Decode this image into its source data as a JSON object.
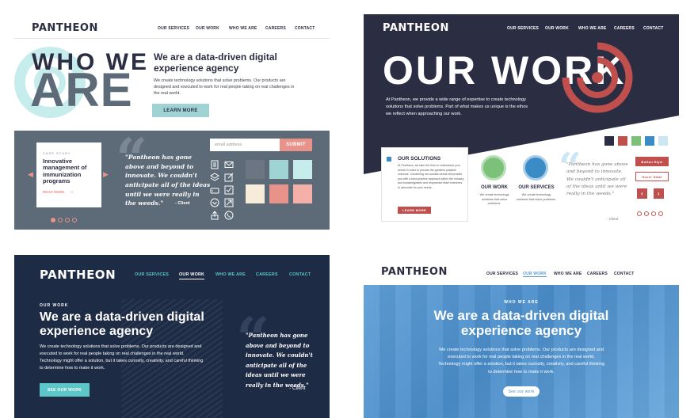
{
  "brand": "PANTHEON",
  "nav_items": [
    "OUR SERVICES",
    "OUR WORK",
    "WHO WE ARE",
    "CAREERS",
    "CONTACT"
  ],
  "panel1": {
    "hero_big_1": "WHO WE",
    "hero_big_2": "ARE",
    "headline": "We are a data-driven digital experience agency",
    "body": "We create technology solutions that solve problems.  Our products are designed and executed to work for real people taking on real challenges in the real world.",
    "cta": "LEARN MORE",
    "case_study_label": "CASE STUDY",
    "case_study_title": "Innovative management of immunization programs",
    "read_more": "READ MORE",
    "quote": "\"Pantheon has gone above and beyond to innovate. We couldn't anticipate all of the ideas until we were really in the weeds.\"",
    "quote_author": "- Client",
    "email_placeholder": "email address",
    "submit": "SUBMIT"
  },
  "panel2": {
    "hero": "OUR WORK",
    "intro": "At Pantheon, we provide a wide range of expertise to create technology solutions that solve problems. Part of what makes us unique is the ethos we reflect when approaching our work.",
    "solutions_title": "OUR SOLUTIONS",
    "solutions_body": "At Pantheon, we take the time to understand your needs in order to provide the greatest possible outcome. Combining our solution areas will provide you with a best-practice approach within the industry and knowledgeable and responsive team members to advocate for your needs.",
    "solutions_btn": "LEARN MORE",
    "feature1_title": "OUR WORK",
    "feature1_body": "We create technology solutions that solve problems.",
    "feature2_title": "OUR SERVICES",
    "feature2_body": "We create technology solutions that solve problems.",
    "quote": "\"Pantheon has gone above and beyond to innovate. We couldn't anticipate all of the ideas until we were really in the weeds.\"",
    "quote_author": "- Client",
    "button_style": "Button Style",
    "hover_state": "Hover State"
  },
  "panel3": {
    "eyebrow": "OUR WORK",
    "headline": "We are a data-driven digital experience agency",
    "body": "We create technology solutions that solve problems.  Our products are designed and executed to work for real people taking on real challenges in the real world.  Technology might offer a solution, but it takes curiosity, creativity, and careful thinking to determine how to make it work.",
    "cta": "SEE OUR WORK",
    "quote": "\"Pantheon has gone above and beyond to innovate. We couldn't anticipate all of the ideas until we were really in the weeds.\"",
    "quote_author": "- Client"
  },
  "panel4": {
    "eyebrow": "WHO WE ARE",
    "headline": "We are a data-driven digital experience agency",
    "body": "We create technology solutions that solve problems.  Our products are designed and executed to work for real people taking on real challenges in the real world.  Technology might offer a solution, but it takes curiosity, creativity, and careful thinking to determine how to make it work.",
    "cta": "See our work"
  },
  "colors": {
    "navy": "#2b2d42",
    "slate": "#5d6a78",
    "teal": "#9fd3d4",
    "salmon": "#e9928a",
    "red": "#c0504d",
    "dark_blue": "#1e2b44",
    "sky": "#5a9bd5",
    "cream": "#f6ecd9"
  },
  "icons": [
    "document-icon",
    "mail-icon",
    "layers-icon",
    "edit-icon",
    "hard-drive-icon",
    "check-square-icon",
    "download-icon",
    "send-icon",
    "upload-icon",
    "phone-icon"
  ]
}
